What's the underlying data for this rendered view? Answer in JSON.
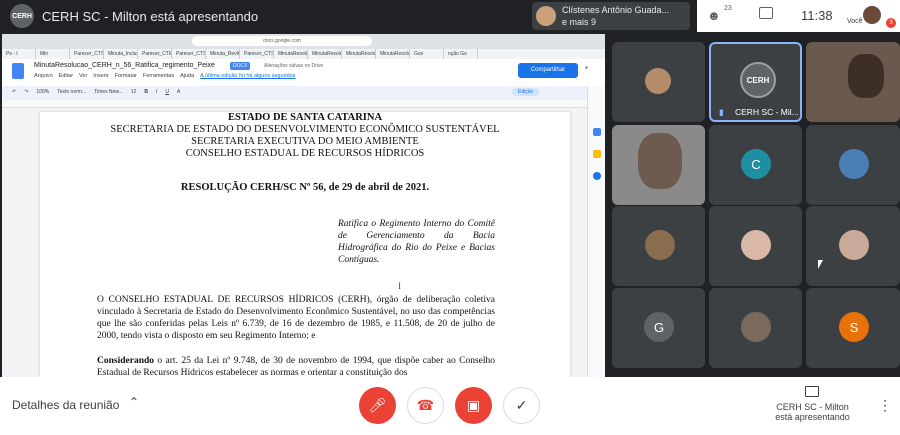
{
  "meeting": {
    "title": "CERH SC - Milton está apresentando",
    "logo_text": "CERH",
    "active_speaker_name": "Clístenes Antônio Guada...",
    "active_speaker_sub": "e mais 9",
    "participant_count": "23",
    "time": "11:38",
    "self_label": "Você",
    "notification_badge": "3"
  },
  "browser": {
    "url": "docs.google.com",
    "tabs": [
      "Ps - I",
      "Min",
      "Parecer_CTS_S...",
      "Minuta_Inclusã...",
      "Parecer_CTE2...",
      "Parecer_CTS_S...",
      "Minuta_RevItP...",
      "Parecer_CTS_S...",
      "MinutaResolu...",
      "MinutaResolu...",
      "MinutaResolu...",
      "MinutaResolu...",
      "Gos",
      "nção Go"
    ]
  },
  "docs": {
    "title": "MinutaResolucao_CERH_n_56_Ratifica_regimento_Peixe",
    "badge": "DOCX",
    "saved_status": "Alterações salvas no Drive",
    "menu": [
      "Arquivo",
      "Editar",
      "Ver",
      "Inserir",
      "Formatar",
      "Ferramentas",
      "Ajuda"
    ],
    "last_edit": "A última edição foi há alguns segundos",
    "share_label": "Compartilhar",
    "toolbar": [
      "100%",
      "Texto norm...",
      "Times New...",
      "12",
      "B",
      "I",
      "U",
      "A"
    ],
    "edit_mode": "Edição"
  },
  "document": {
    "header": [
      "ESTADO DE SANTA CATARINA",
      "SECRETARIA DE ESTADO DO DESENVOLVIMENTO ECONÔMICO SUSTENTÁVEL",
      "SECRETARIA EXECUTIVA DO MEIO AMBIENTE",
      "CONSELHO ESTADUAL DE RECURSOS HÍDRICOS"
    ],
    "resolution_title": "RESOLUÇÃO CERH/SC Nº 56, de 29 de abril de 2021.",
    "ementa": "Ratifica o Regimento Interno do Comitê de Gerenciamento da Bacia Hidrográfica do Rio do Peixe e Bacias Contíguas.",
    "cursor": "I",
    "para1_bold": "O CONSELHO ESTADUAL DE RECURSOS HÍDRICOS (CERH),",
    "para1_rest": " órgão de deliberação coletiva vinculado à Secretaria de Estado do Desenvolvimento Econômico Sustentável, no uso das competências que lhe são conferidas pelas Leis nº 6.739, de 16 de dezembro de 1985, e 11.508, de 20 de julho de 2000, tendo vista o disposto em seu Regimento Interno; e",
    "para2_bold": "Considerando",
    "para2_rest": " o art. 25 da Lei nº 9.748, de 30 de novembro de 1994, que dispõe caber ao Conselho Estadual de Recursos Hídricos estabelecer as normas e orientar a constituição dos"
  },
  "participants": {
    "presenter_label": "CERH SC - Mil...",
    "presenter_avatar_text": "CERH",
    "tiles": [
      {
        "initial": "C",
        "color": "#1e8fa3"
      },
      {
        "initial": "G",
        "color": "#5f6368"
      },
      {
        "initial": "S",
        "color": "#e8710a"
      }
    ]
  },
  "controls": {
    "details_label": "Detalhes da reunião",
    "presenting_label_1": "CERH SC - Milton",
    "presenting_label_2": "está apresentando"
  }
}
